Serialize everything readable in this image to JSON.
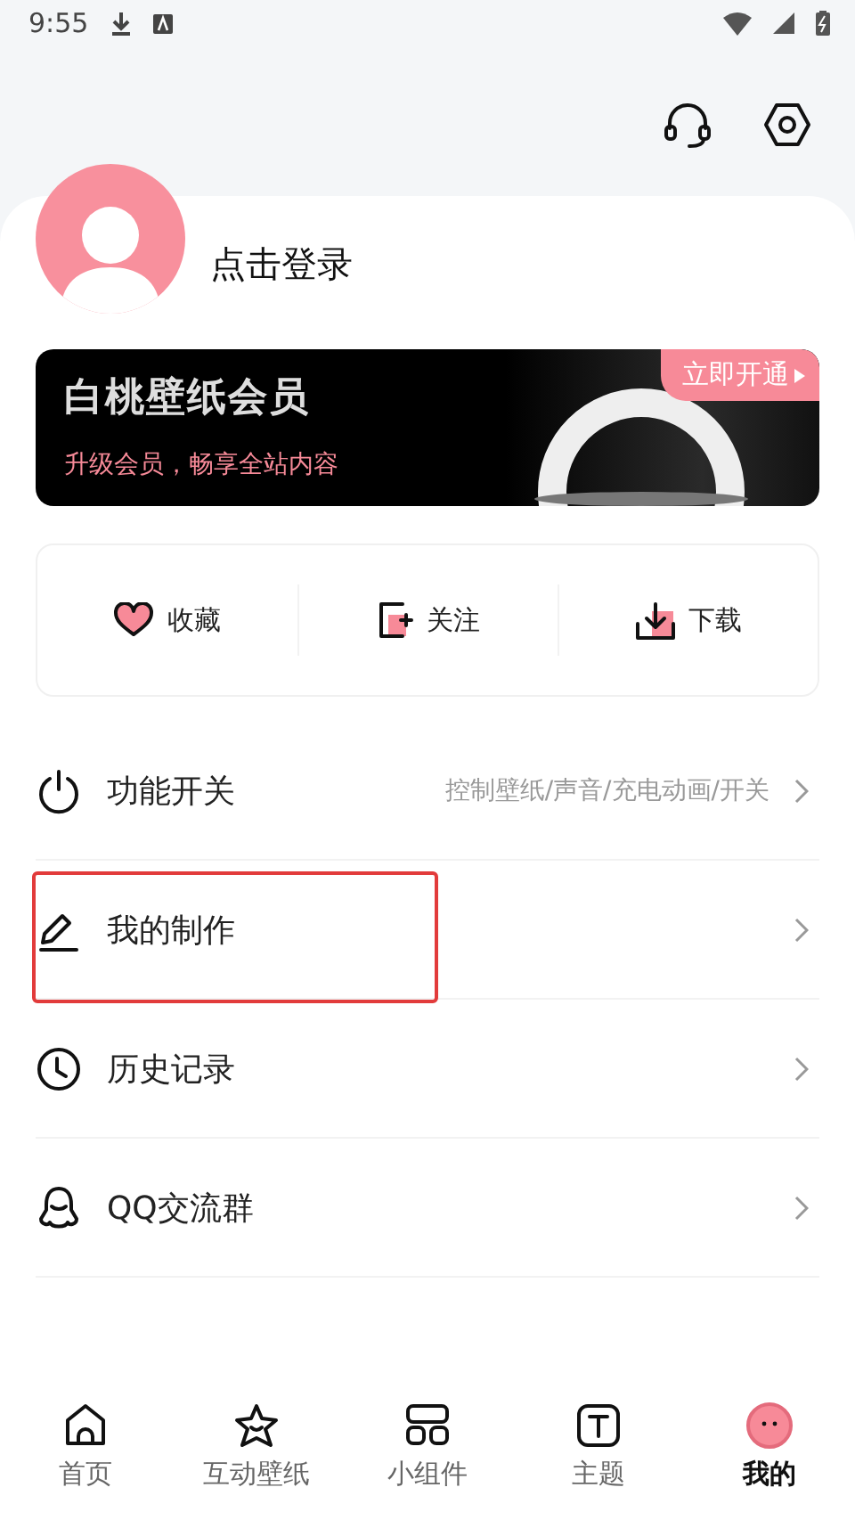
{
  "status_bar": {
    "time": "9:55"
  },
  "profile": {
    "name": "点击登录"
  },
  "banner": {
    "title": "白桃壁纸会员",
    "subtitle": "升级会员，畅享全站内容",
    "button": "立即开通"
  },
  "quick_actions": [
    {
      "kind": "heart",
      "label": "收藏"
    },
    {
      "kind": "follow",
      "label": "关注"
    },
    {
      "kind": "download",
      "label": "下载"
    }
  ],
  "menu": [
    {
      "kind": "power",
      "label": "功能开关",
      "hint": "控制壁纸/声音/充电动画/开关",
      "highlighted": false
    },
    {
      "kind": "pen",
      "label": "我的制作",
      "highlighted": true
    },
    {
      "kind": "clock",
      "label": "历史记录",
      "highlighted": false
    },
    {
      "kind": "penguin",
      "label": "QQ交流群",
      "highlighted": false
    }
  ],
  "tabs": [
    {
      "kind": "home",
      "label": "首页",
      "selected": false
    },
    {
      "kind": "star",
      "label": "互动壁纸",
      "selected": false
    },
    {
      "kind": "widgets",
      "label": "小组件",
      "selected": false
    },
    {
      "kind": "theme",
      "label": "主题",
      "selected": false
    },
    {
      "kind": "me",
      "label": "我的",
      "selected": true
    }
  ]
}
